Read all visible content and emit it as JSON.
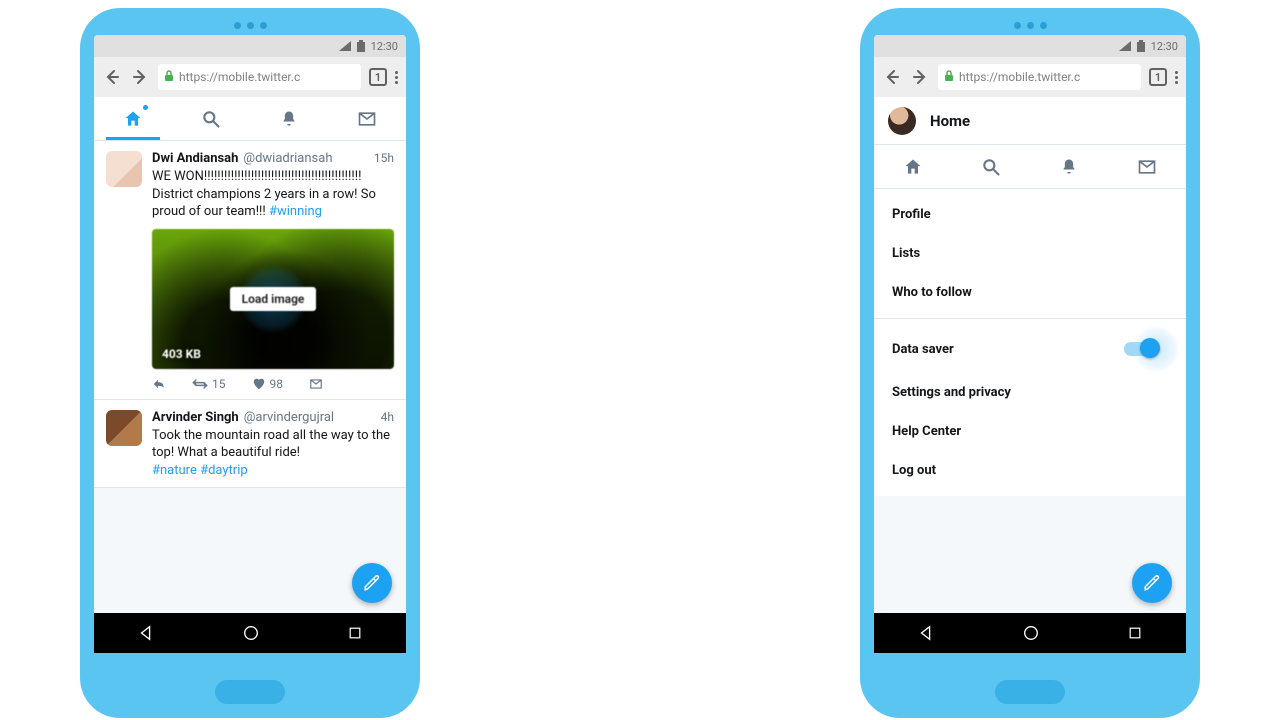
{
  "statusbar": {
    "time": "12:30"
  },
  "browser": {
    "url": "https://mobile.twitter.c",
    "tab_count": "1"
  },
  "tabs": {
    "items": [
      {
        "name": "home"
      },
      {
        "name": "search"
      },
      {
        "name": "notifications"
      },
      {
        "name": "messages"
      }
    ]
  },
  "feed": {
    "tweets": [
      {
        "name": "Dwi Andiansah",
        "handle": "@dwiadriansah",
        "time": "15h",
        "text": "WE WON!!!!!!!!!!!!!!!!!!!!!!!!!!!!!!!!!!!!!!!!!!!!!!! District champions 2 years in a row! So proud of our team!!! ",
        "hashtag": "#winning",
        "media_size": "403 KB",
        "load_label": "Load image",
        "retweets": "15",
        "likes": "98"
      },
      {
        "name": "Arvinder Singh",
        "handle": "@arvindergujral",
        "time": "4h",
        "text": "Took the mountain road all the way to the top! What a beautiful ride!",
        "hashtags": "#nature #daytrip"
      }
    ]
  },
  "home": {
    "title": "Home"
  },
  "menu": {
    "section1": [
      {
        "label": "Profile"
      },
      {
        "label": "Lists"
      },
      {
        "label": "Who to follow"
      }
    ],
    "section2": [
      {
        "label": "Data saver",
        "toggle": true
      },
      {
        "label": "Settings and privacy"
      },
      {
        "label": "Help Center"
      },
      {
        "label": "Log out"
      }
    ]
  }
}
